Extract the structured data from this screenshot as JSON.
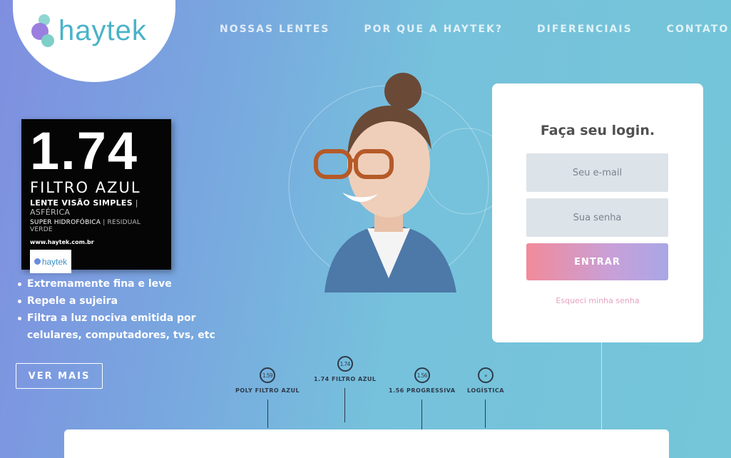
{
  "brand": {
    "name": "haytek"
  },
  "nav": {
    "items": [
      "NOSSAS LENTES",
      "POR QUE A HAYTEK?",
      "DIFERENCIAIS",
      "CONTATO"
    ]
  },
  "promo": {
    "number": "1.74",
    "subtitle": "FILTRO AZUL",
    "line1_main": "LENTE VISÃO SIMPLES",
    "line1_muted": " | ASFÉRICA",
    "line2_main": "SUPER HIDROFÓBICA",
    "line2_muted": " | RESIDUAL VERDE",
    "url": "www.haytek.com.br",
    "badge": "haytek"
  },
  "features": [
    "Extremamente fina e leve",
    "Repele a sujeira",
    "Filtra a luz nociva emitida por celulares, computadores, tvs, etc"
  ],
  "cta": {
    "more_label": "VER MAIS"
  },
  "login": {
    "title": "Faça seu login.",
    "email_placeholder": "Seu e-mail",
    "password_placeholder": "Sua senha",
    "submit_label": "ENTRAR",
    "forgot_label": "Esqueci minha senha"
  },
  "timeline": [
    {
      "badge": "1.59",
      "label": "POLY FILTRO AZUL"
    },
    {
      "badge": "1.74",
      "label": "1.74 FILTRO AZUL"
    },
    {
      "badge": "1.56",
      "label": "1.56 PROGRESSIVA"
    },
    {
      "badge": "»",
      "label": "LOGÍSTICA"
    }
  ],
  "colors": {
    "accent_pink": "#f28a9a",
    "accent_lavender": "#a9a6e6",
    "logo_teal": "#4ab3c8",
    "field_bg": "#dce3e9"
  }
}
